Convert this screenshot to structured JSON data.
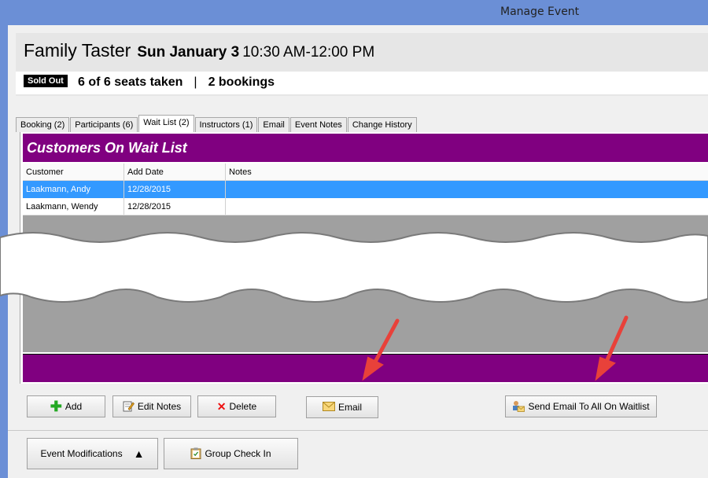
{
  "window": {
    "title": "Manage Event"
  },
  "event": {
    "name": "Family Taster",
    "date": "Sun January 3",
    "time": "10:30 AM-12:00 PM"
  },
  "status": {
    "badge": "Sold Out",
    "seats": "6 of 6 seats taken",
    "separator": "|",
    "bookings": "2 bookings"
  },
  "tabs": [
    {
      "label": "Booking (2)"
    },
    {
      "label": "Participants (6)"
    },
    {
      "label": "Wait List (2)",
      "active": true
    },
    {
      "label": "Instructors (1)"
    },
    {
      "label": "Email"
    },
    {
      "label": "Event Notes"
    },
    {
      "label": "Change History"
    }
  ],
  "waitlist": {
    "title": "Customers On Wait List",
    "columns": [
      "Customer",
      "Add Date",
      "Notes"
    ],
    "rows": [
      {
        "customer": "Laakmann, Andy",
        "add_date": "12/28/2015",
        "notes": "",
        "selected": true
      },
      {
        "customer": "Laakmann, Wendy",
        "add_date": "12/28/2015",
        "notes": "",
        "selected": false
      }
    ]
  },
  "actions": {
    "add": "Add",
    "edit_notes": "Edit Notes",
    "delete": "Delete",
    "email": "Email",
    "send_all": "Send Email To All On Waitlist"
  },
  "footer": {
    "event_modifications": "Event Modifications",
    "group_check_in": "Group Check In"
  },
  "colors": {
    "accent": "#800080",
    "selection": "#3399ff",
    "title_bar": "#6b8fd6"
  }
}
